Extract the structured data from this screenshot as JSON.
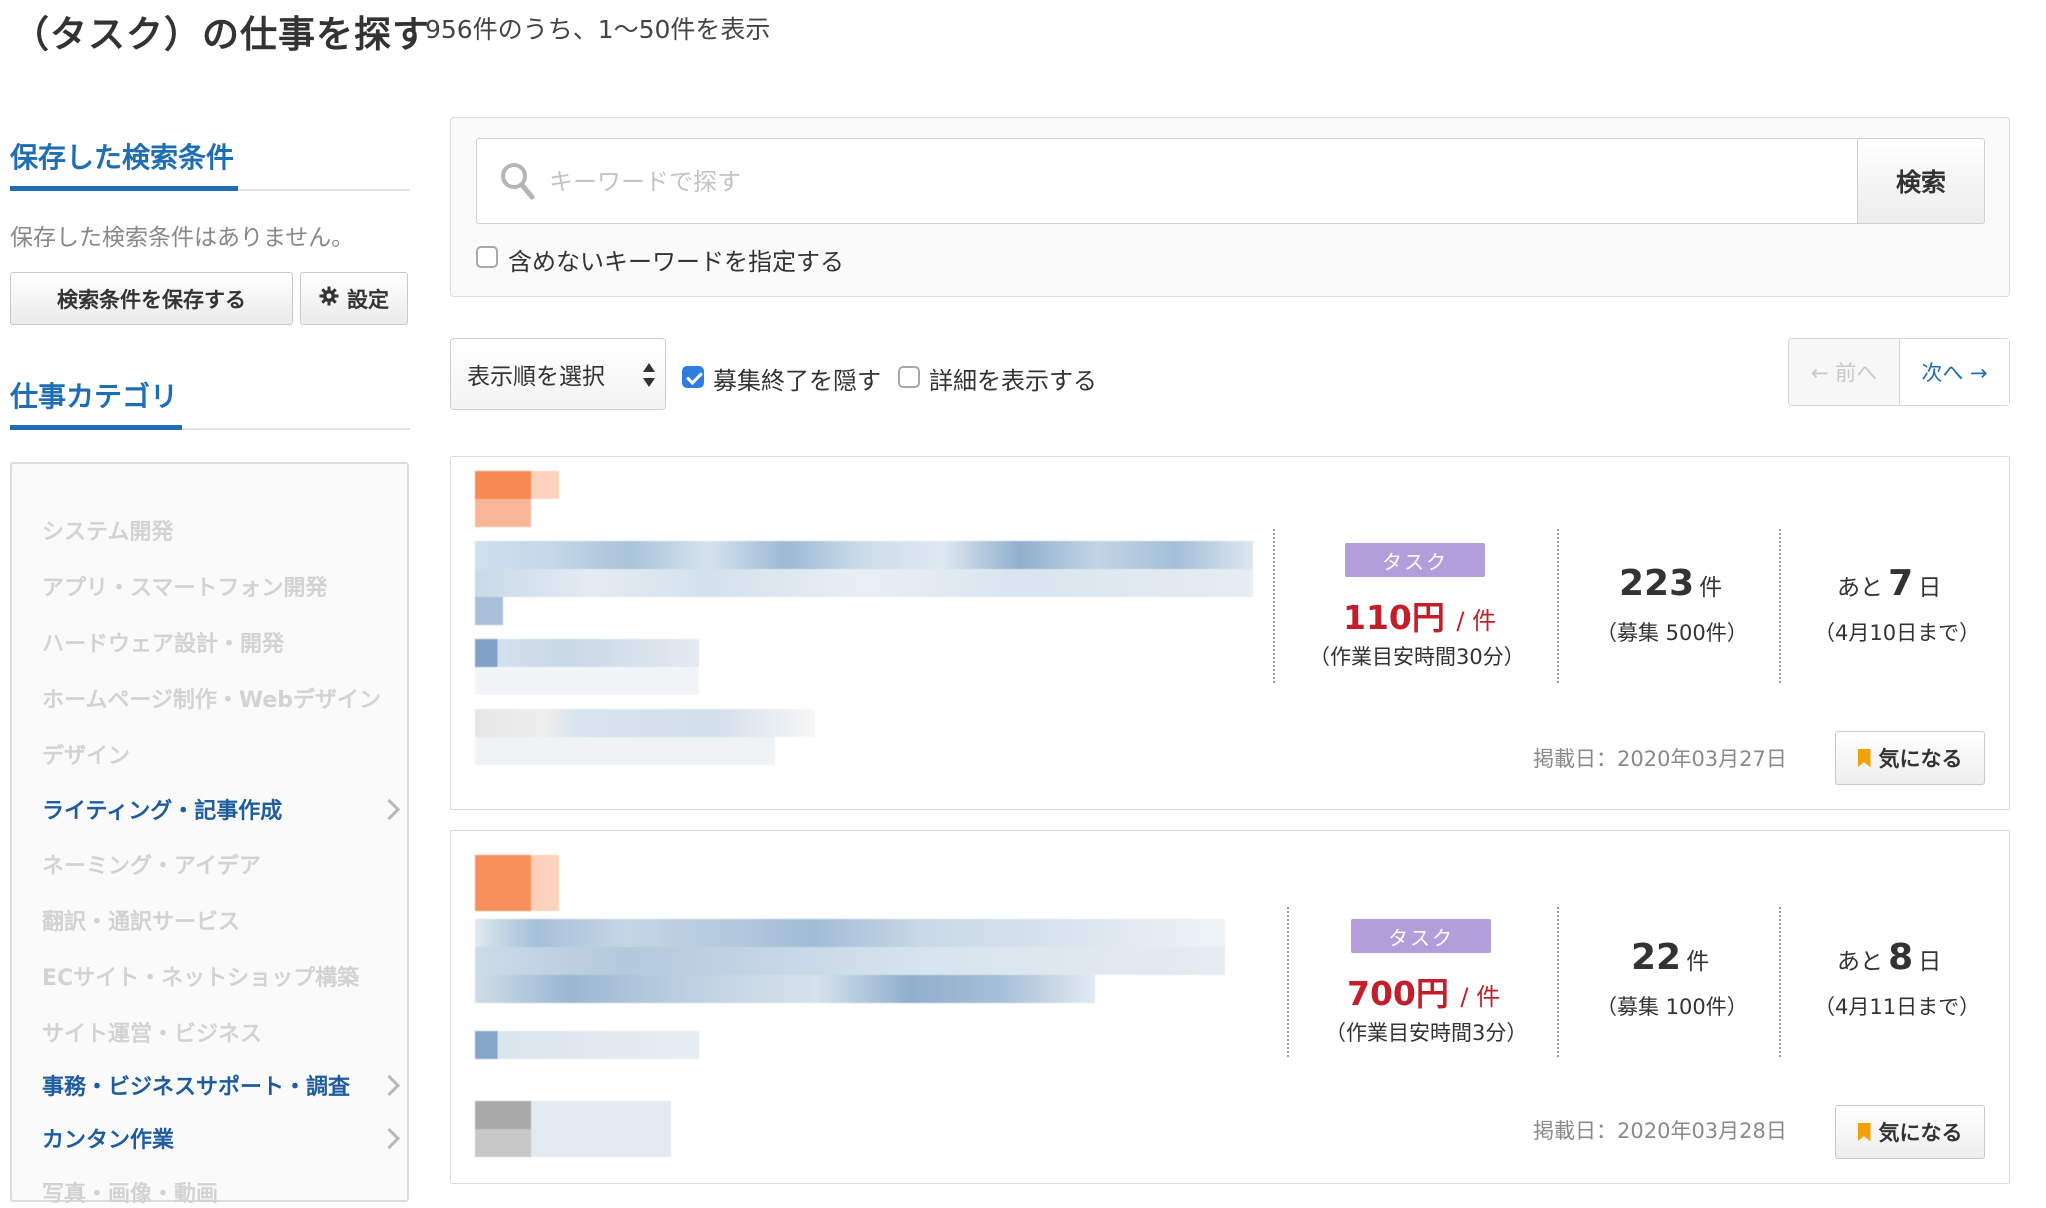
{
  "header": {
    "title": "（タスク）の仕事を探す",
    "result_count": "956件のうち、1〜50件を表示"
  },
  "sidebar": {
    "saved_search": {
      "heading": "保存した検索条件",
      "empty_message": "保存した検索条件はありません。",
      "save_button": "検索条件を保存する",
      "settings_button": "設定"
    },
    "category": {
      "heading": "仕事カテゴリ",
      "items": [
        {
          "label": "システム開発",
          "active": false
        },
        {
          "label": "アプリ・スマートフォン開発",
          "active": false
        },
        {
          "label": "ハードウェア設計・開発",
          "active": false
        },
        {
          "label": "ホームページ制作・Webデザイン",
          "active": false
        },
        {
          "label": "デザイン",
          "active": false
        },
        {
          "label": "ライティング・記事作成",
          "active": true
        },
        {
          "label": "ネーミング・アイデア",
          "active": false
        },
        {
          "label": "翻訳・通訳サービス",
          "active": false
        },
        {
          "label": "ECサイト・ネットショップ構築",
          "active": false
        },
        {
          "label": "サイト運営・ビジネス",
          "active": false
        },
        {
          "label": "事務・ビジネスサポート・調査",
          "active": true
        },
        {
          "label": "カンタン作業",
          "active": true
        },
        {
          "label": "写真・画像・動画",
          "active": false
        }
      ]
    }
  },
  "search": {
    "placeholder": "キーワードで探す",
    "value": "",
    "button": "検索",
    "exclude_label": "含めないキーワードを指定する",
    "exclude_checked": false
  },
  "toolbar": {
    "sort_label": "表示順を選択",
    "hide_closed_label": "募集終了を隠す",
    "hide_closed_checked": true,
    "show_details_label": "詳細を表示する",
    "show_details_checked": false
  },
  "pager": {
    "prev": "← 前へ",
    "next": "次へ →"
  },
  "jobs": [
    {
      "type": "タスク",
      "price": "110円",
      "price_unit": "/ 件",
      "work_time": "（作業目安時間30分）",
      "count": "223",
      "count_unit": "件",
      "recruit": "（募集 500件）",
      "remaining_prefix": "あと",
      "remaining_days": "7",
      "remaining_unit": "日",
      "deadline": "（4月10日まで）",
      "posted": "掲載日：2020年03月27日",
      "fav_label": "気になる"
    },
    {
      "type": "タスク",
      "price": "700円",
      "price_unit": "/ 件",
      "work_time": "（作業目安時間3分）",
      "count": "22",
      "count_unit": "件",
      "recruit": "（募集 100件）",
      "remaining_prefix": "あと",
      "remaining_days": "8",
      "remaining_unit": "日",
      "deadline": "（4月11日まで）",
      "posted": "掲載日：2020年03月28日",
      "fav_label": "気になる"
    }
  ],
  "colors": {
    "accent_blue": "#1f6db3",
    "price_red": "#c21f2a",
    "badge_purple": "#b39ddb",
    "bookmark_orange": "#f1a20b",
    "checkbox_blue": "#2f7de1"
  },
  "icons": [
    "search-icon",
    "gear-icon",
    "bookmark-icon",
    "chevron-right-icon",
    "select-arrows-icon"
  ]
}
